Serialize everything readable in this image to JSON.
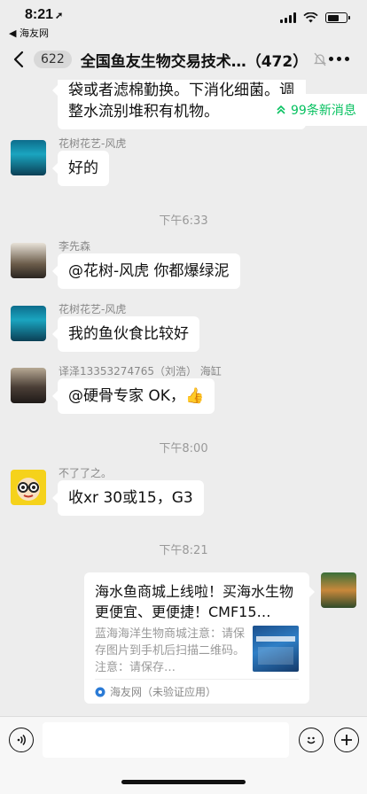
{
  "status_bar": {
    "time": "8:21",
    "back_app": "◀ 海友网",
    "battery_level": 0.6
  },
  "nav": {
    "unread_count": "622",
    "title": "全国鱼友生物交易技术…（472）"
  },
  "new_messages": {
    "label": "99条新消息"
  },
  "messages": [
    {
      "type": "text",
      "sender": "",
      "text": "袋或者滤棉勤换。下消化细菌。调整水流别堆积有机物。"
    },
    {
      "type": "text",
      "sender": "花树花艺-风虎",
      "text": "好的"
    },
    {
      "type": "time",
      "text": "下午6:33"
    },
    {
      "type": "text",
      "sender": "李先森",
      "text": "@花树-风虎 你都爆绿泥"
    },
    {
      "type": "text",
      "sender": "花树花艺-风虎",
      "text": "我的鱼伙食比较好"
    },
    {
      "type": "text",
      "sender": "译泽13353274765（刘浩） 海缸",
      "text": "@硬骨专家 OK，"
    },
    {
      "type": "time",
      "text": "下午8:00"
    },
    {
      "type": "text",
      "sender": "不了了之。",
      "text": "收xr 30或15，G3"
    },
    {
      "type": "time",
      "text": "下午8:21"
    }
  ],
  "card": {
    "title": "海水鱼商城上线啦！买海水生物更便宜、更便捷！CMF15…",
    "description": "蓝海海洋生物商城注意：请保存图片到手机后扫描二维码。注意：请保存…",
    "source": "海友网（未验证应用）"
  },
  "colors": {
    "accent": "#07c160",
    "background": "#ededed",
    "bubble": "#ffffff"
  }
}
